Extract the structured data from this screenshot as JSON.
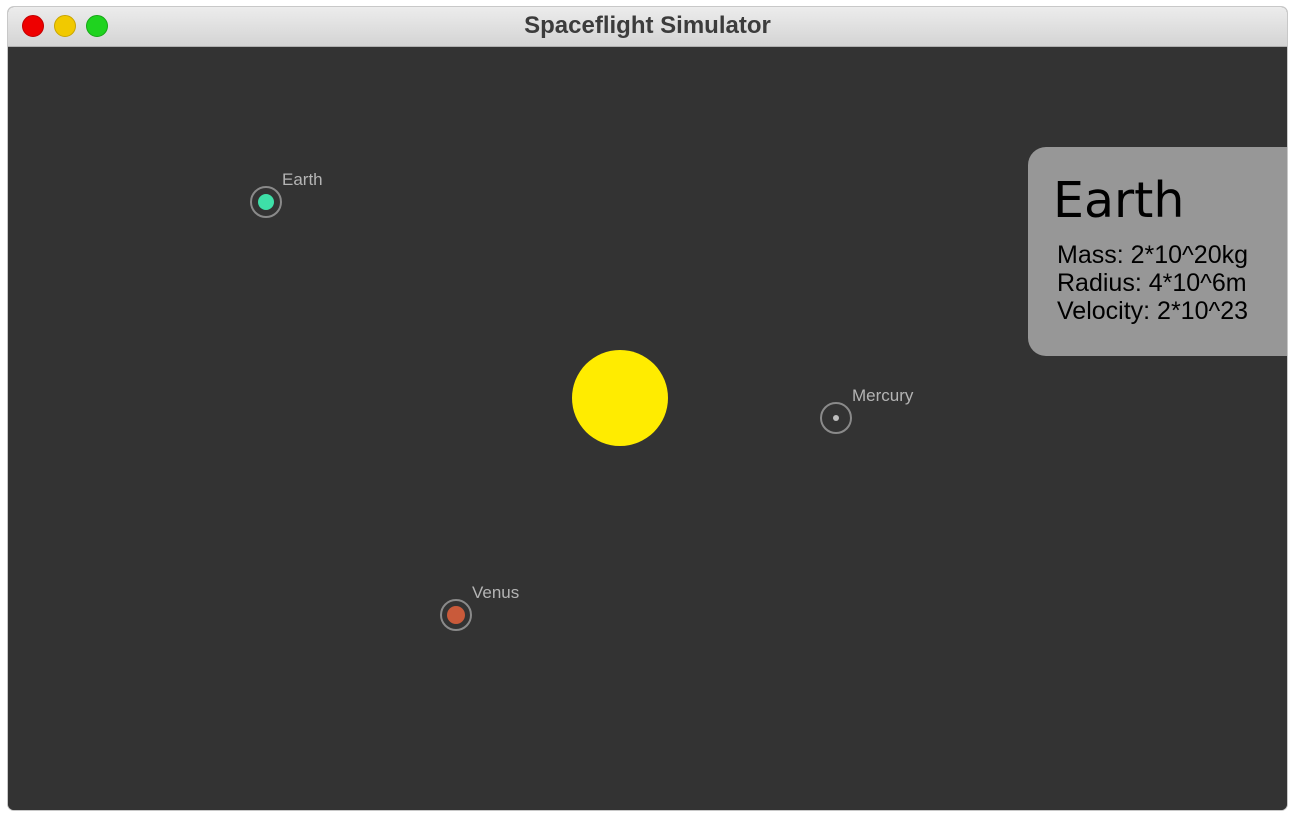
{
  "window": {
    "title": "Spaceflight Simulator"
  },
  "sun": {
    "color": "#ffec00"
  },
  "planets": [
    {
      "name": "Earth",
      "color": "#3ee0a8"
    },
    {
      "name": "Mercury",
      "color": "#bdbdbd"
    },
    {
      "name": "Venus",
      "color": "#c95a3a"
    }
  ],
  "info_panel": {
    "name": "Earth",
    "mass": "Mass: 2*10^20kg",
    "radius": "Radius: 4*10^6m",
    "velocity": "Velocity: 2*10^23"
  },
  "colors": {
    "background": "#333333",
    "panel": "#979797",
    "orbit_ring": "#8a8a8a",
    "label": "#b4b4b4"
  }
}
